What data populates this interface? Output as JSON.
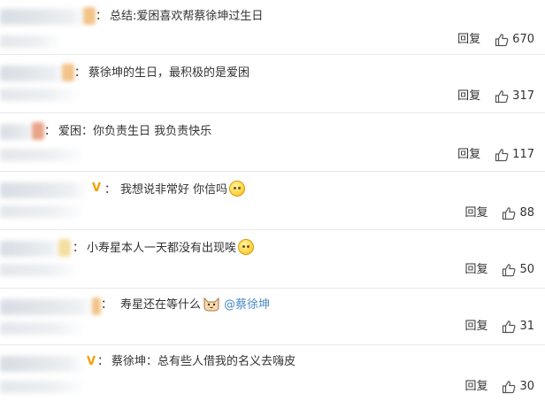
{
  "comments": [
    {
      "text": "总结:爱困喜欢帮蔡徐坤过生日",
      "reply_label": "回复",
      "likes": "670",
      "has_v": false,
      "emoji": null,
      "mention": null,
      "prefix": "："
    },
    {
      "text": "蔡徐坤的生日，最积极的是爱困",
      "reply_label": "回复",
      "likes": "317",
      "has_v": false,
      "emoji": null,
      "mention": null,
      "prefix": "："
    },
    {
      "text": "爱困：你负责生日 我负责快乐",
      "reply_label": "回复",
      "likes": "117",
      "has_v": false,
      "emoji": null,
      "mention": null,
      "prefix": "："
    },
    {
      "text": "我想说非常好 你信吗",
      "reply_label": "回复",
      "likes": "88",
      "has_v": true,
      "emoji": "smile-emoji",
      "mention": null,
      "prefix": "："
    },
    {
      "text": "小寿星本人一天都没有出现唉",
      "reply_label": "回复",
      "likes": "50",
      "has_v": false,
      "emoji": "sad-emoji",
      "mention": null,
      "prefix": "："
    },
    {
      "text": "寿星还在等什么",
      "reply_label": "回复",
      "likes": "31",
      "has_v": false,
      "emoji": "cat-emoji",
      "mention": "@蔡徐坤",
      "prefix": "："
    },
    {
      "text": "蔡徐坤：总有些人借我的名义去嗨皮",
      "reply_label": "回复",
      "likes": "30",
      "has_v": true,
      "emoji": null,
      "mention": null,
      "prefix": "："
    }
  ],
  "colors": {
    "mention": "#4a8ac9",
    "vbadge": "#f0a000",
    "divider": "#e9e9e9"
  }
}
